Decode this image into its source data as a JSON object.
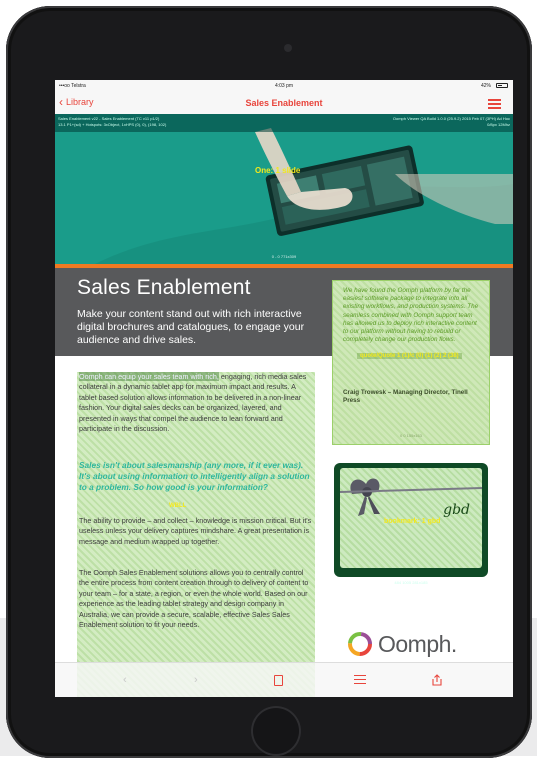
{
  "status_bar": {
    "carrier": "•••oo Telstra",
    "time": "4:03 pm",
    "battery": "42%"
  },
  "nav": {
    "back_label": "Library",
    "title": "Sales Enablement"
  },
  "debug": {
    "left_line1": "Sales Enablement v22 - Sales Enablement (TC v11 p1/2)",
    "left_line2": "13.1 P1+(sd) + Hotspots: 3xObject, 1xHPS (0), 0), (198, 102)",
    "right_line1": "Oomph Viewer QA Build 1.0.0 (25.9.2) 2015 Feb 07 (3PH) Ad Hoc",
    "right_line2": "0/8px 12Mhz"
  },
  "hero": {
    "label": "One: 1 slide",
    "coords": "0 - 0 771x309"
  },
  "banner": {
    "title": "Sales Enablement",
    "subtitle": "Make your content stand out with rich interactive digital brochures and catalogues, to engage your audience and drive sales."
  },
  "quote": {
    "text": "We have found the Oomph platform by far the easiest software package to integrate into all existing workflows, and production systems. The seamless combined with Oomph support team has allowed us to deploy rich interactive content to our platform without having to rebuild or completely change our production flows.",
    "badge": "quote/Quote 1 (1)/c (0) (1) (2) 2 (38)",
    "author": "Craig Trowesk – Managing Director, Tinell Press",
    "footer": "0 0 155x163"
  },
  "image_card": {
    "label": "bookmark: 1 gbd",
    "brand": "gbd",
    "coords": "484 1005 281x185"
  },
  "body": {
    "p1_highlight": "Oomph can equip your sales team with rich,",
    "p1_rest": "engaging, rich media sales collateral in a dynamic tablet app for maximum impact and results. A tablet based solution allows information to be delivered in a non-linear fashion. Your digital sales decks can be organized, layered, and presented in ways that compel the audience to lean forward and participate in the discussion.",
    "lead": "Sales isn't about salesmanship (any more, if it ever was). It's about using information to intelligently align a solution to a problem. So how good is your information?",
    "lead_badge": "WBLL",
    "p2": "The ability to provide – and collect – knowledge is mission critical. But it's useless unless your delivery captures mindshare. A great presentation is message and medium wrapped up together.",
    "p3": "The Oomph Sales Enablement solutions allows you to centrally control the entire process from content creation through to delivery of content to your team – for a state, a region, or even the whole world. Based on our experience as the leading tablet strategy and design company in Australia, we can provide a secure, scalable, effective Sales Sales Enablement solution to fit your needs."
  },
  "logo": {
    "text": "Oomph."
  },
  "colors": {
    "accent": "#e8453c",
    "banner": "#58595b",
    "teal": "#1a9c8a",
    "orange": "#f07a22"
  }
}
